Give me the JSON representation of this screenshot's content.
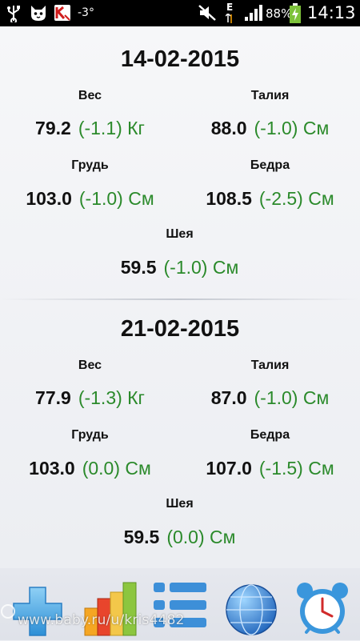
{
  "status_bar": {
    "temperature": "-3°",
    "network": "E",
    "battery": "88%",
    "time": "14:13"
  },
  "entries": [
    {
      "date": "14-02-2015",
      "weight": {
        "label": "Вес",
        "value": "79.2",
        "delta": "(-1.1) Кг"
      },
      "waist": {
        "label": "Талия",
        "value": "88.0",
        "delta": "(-1.0) См"
      },
      "chest": {
        "label": "Грудь",
        "value": "103.0",
        "delta": "(-1.0) См"
      },
      "hips": {
        "label": "Бедра",
        "value": "108.5",
        "delta": "(-2.5) См"
      },
      "neck": {
        "label": "Шея",
        "value": "59.5",
        "delta": "(-1.0) См"
      }
    },
    {
      "date": "21-02-2015",
      "weight": {
        "label": "Вес",
        "value": "77.9",
        "delta": "(-1.3) Кг"
      },
      "waist": {
        "label": "Талия",
        "value": "87.0",
        "delta": "(-1.0) См"
      },
      "chest": {
        "label": "Грудь",
        "value": "103.0",
        "delta": "(0.0) См"
      },
      "hips": {
        "label": "Бедра",
        "value": "107.0",
        "delta": "(-1.5) См"
      },
      "neck": {
        "label": "Шея",
        "value": "59.5",
        "delta": "(0.0) См"
      }
    }
  ],
  "toolbar": {
    "buttons": [
      {
        "icon": "add-icon"
      },
      {
        "icon": "bar-chart-icon"
      },
      {
        "icon": "list-icon"
      },
      {
        "icon": "globe-icon"
      },
      {
        "icon": "alarm-clock-icon"
      }
    ]
  },
  "watermark": "www.baby.ru/u/kris4482",
  "colors": {
    "delta": "#2b8a2b",
    "status_bg": "#000000"
  }
}
